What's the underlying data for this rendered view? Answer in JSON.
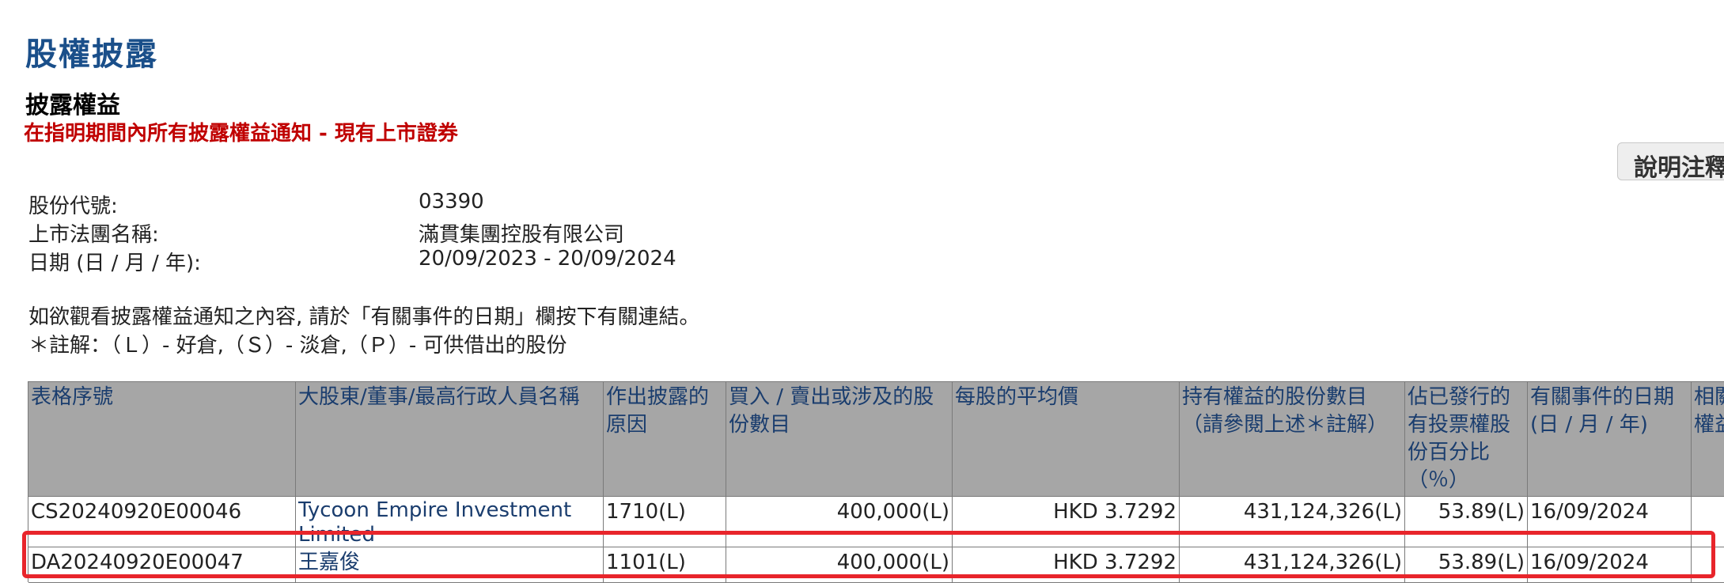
{
  "header": {
    "page_heading": "股權披露",
    "section_title": "披露權益",
    "section_subtitle": "在指明期間內所有披露權益通知 - 現有上市證券",
    "help_button_label": "說明注釋"
  },
  "info": {
    "stock_code_label": "股份代號:",
    "stock_code_value": "03390",
    "company_label": "上市法團名稱:",
    "company_value": "滿貫集團控股有限公司",
    "date_label": "日期 (日 / 月 / 年):",
    "date_value": "20/09/2023 - 20/09/2024"
  },
  "notes": {
    "line1": "如欲觀看披露權益通知之內容, 請於「有關事件的日期」欄按下有關連結。",
    "line2": "＊註解：（Ｌ）- 好倉,（Ｓ）- 淡倉,（Ｐ）- 可供借出的股份"
  },
  "table": {
    "headers": [
      "表格序號",
      "大股東/董事/最高行政人員名稱",
      "作出披露的原因",
      "買入 / 賣出或涉及的股份數目",
      "每股的平均價",
      "持有權益的股份數目（請參閱上述＊註解）",
      "佔已發行的有投票權股份百分比（％）",
      "有關事件的日期 (日 / 月 / 年)",
      "相關權益"
    ],
    "rows": [
      {
        "form_no": "CS20240920E00046",
        "name": "Tycoon Empire Investment Limited",
        "reason": "1710(L)",
        "shares_traded": "400,000(L)",
        "avg_price": "HKD 3.7292",
        "shares_held": "431,124,326(L)",
        "pct": "53.89(L)",
        "event_date": "16/09/2024"
      },
      {
        "form_no": "DA20240920E00047",
        "name": "王嘉俊",
        "reason": "1101(L)",
        "shares_traded": "400,000(L)",
        "avg_price": "HKD 3.7292",
        "shares_held": "431,124,326(L)",
        "pct": "53.89(L)",
        "event_date": "16/09/2024"
      }
    ]
  },
  "colors": {
    "heading": "#1a4f8a",
    "subtitle": "#c00000",
    "header_bg": "#a6a6a6",
    "highlight": "#e8252b"
  }
}
